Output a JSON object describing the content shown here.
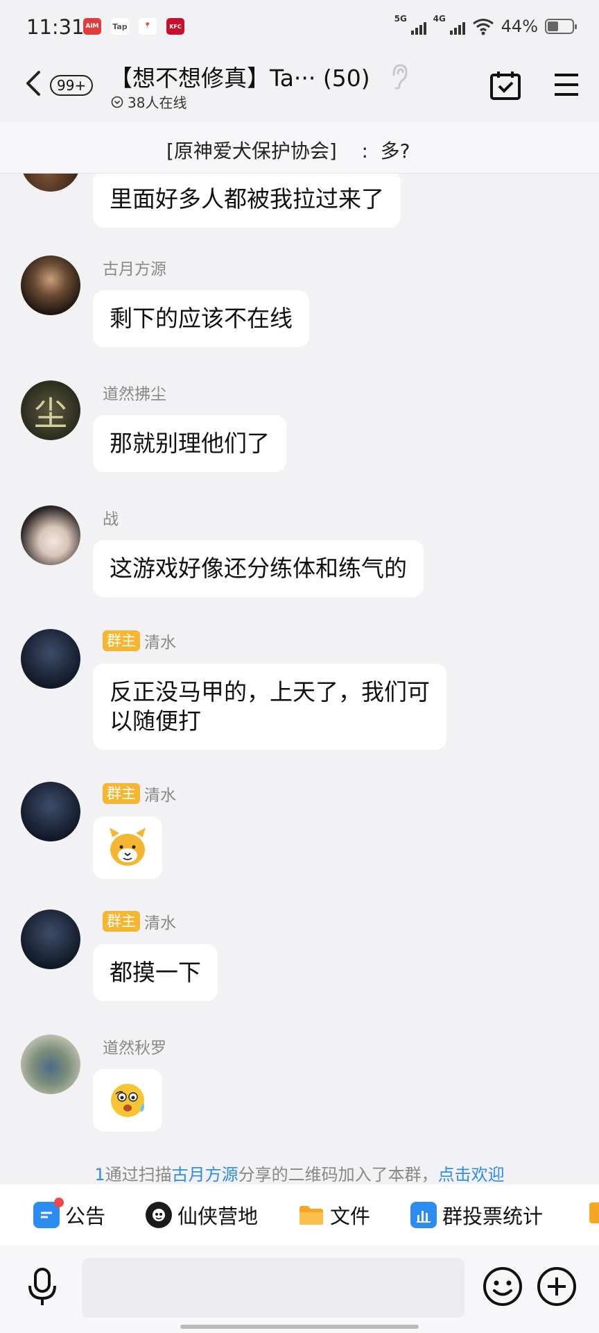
{
  "status_bar": {
    "time": "11:31",
    "apps": [
      {
        "label": "AIM",
        "color": "#e23b3b"
      },
      {
        "label": "Tap",
        "color": "#5a5a5a"
      },
      {
        "label": "📍",
        "color": "#ffffff"
      },
      {
        "label": "KFC",
        "color": "#c8102e"
      }
    ],
    "signal1": "5G",
    "signal2": "4G",
    "battery": "44%",
    "battery_level": 0.44
  },
  "header": {
    "unread": "99+",
    "title": "【想不想修真】Ta··· (50)",
    "online": "38人在线"
  },
  "pinned": {
    "text": "[原神爱犬保护协会]    :  多?"
  },
  "messages": [
    {
      "sender": "",
      "text": "里面好多人都被我拉过来了"
    },
    {
      "sender": "古月方源",
      "text": "剩下的应该不在线"
    },
    {
      "sender": "道然拂尘",
      "text": "那就别理他们了",
      "avatar_char": "尘"
    },
    {
      "sender": "战",
      "text": "这游戏好像还分练体和练气的"
    },
    {
      "sender": "清水",
      "role": "群主",
      "text_line1": "反正没马甲的，上天了，我们可",
      "text_line2": "以随便打"
    },
    {
      "sender": "清水",
      "role": "群主",
      "sticker": "dog-face"
    },
    {
      "sender": "清水",
      "role": "群主",
      "text": "都摸一下"
    },
    {
      "sender": "道然秋罗",
      "sticker": "scared-face"
    }
  ],
  "system_notice": {
    "user": "1",
    "part1": "通过扫描",
    "inviter": "古月方源",
    "part2": "分享的二维码加入了本群，",
    "action": "点击欢迎"
  },
  "toolbar": {
    "items": [
      {
        "label": "公告",
        "icon": "announcement-icon"
      },
      {
        "label": "仙侠营地",
        "icon": "camp-icon"
      },
      {
        "label": "文件",
        "icon": "folder-icon"
      },
      {
        "label": "群投票统计",
        "icon": "chart-icon"
      }
    ]
  },
  "colors": {
    "background": "#f2f2f4",
    "bubble": "#ffffff",
    "role_badge": "#f5b731",
    "link": "#2d8cf0",
    "notice_dot": "#f04848"
  }
}
